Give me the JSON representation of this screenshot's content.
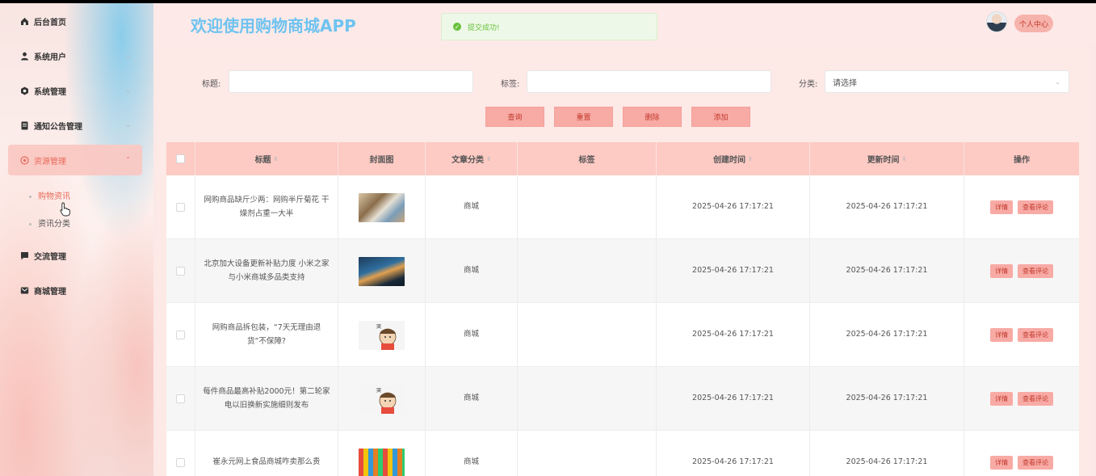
{
  "app": {
    "title": "欢迎使用购物商城APP"
  },
  "toast": {
    "message": "提交成功!"
  },
  "header": {
    "user_button": "个人中心"
  },
  "sidebar": {
    "items": [
      {
        "label": "后台首页",
        "icon": "home-icon",
        "expandable": false
      },
      {
        "label": "系统用户",
        "icon": "user-icon",
        "expandable": true
      },
      {
        "label": "系统管理",
        "icon": "gear-icon",
        "expandable": true
      },
      {
        "label": "通知公告管理",
        "icon": "document-icon",
        "expandable": true
      },
      {
        "label": "资源管理",
        "icon": "resource-icon",
        "expandable": true,
        "active": true
      },
      {
        "label": "交流管理",
        "icon": "chat-icon",
        "expandable": false
      },
      {
        "label": "商城管理",
        "icon": "mail-icon",
        "expandable": false
      }
    ],
    "sub_items": [
      {
        "label": "购物资讯",
        "active": true
      },
      {
        "label": "资讯分类",
        "active": false
      }
    ]
  },
  "search": {
    "title_label": "标题:",
    "tag_label": "标签:",
    "category_label": "分类:",
    "category_placeholder": "请选择",
    "buttons": {
      "query": "查询",
      "reset": "重置",
      "delete": "删除",
      "add": "添加"
    }
  },
  "table": {
    "headers": {
      "title": "标题",
      "cover": "封面图",
      "category": "文章分类",
      "tags": "标签",
      "created": "创建时间",
      "updated": "更新时间",
      "actions": "操作"
    },
    "action_labels": {
      "detail": "详情",
      "comments": "查看评论"
    },
    "rows": [
      {
        "title": "网购商品缺斤少两：网购半斤菊花 干燥剂占重一大半",
        "category": "商城",
        "tags": "",
        "created": "2025-04-26 17:17:21",
        "updated": "2025-04-26 17:17:21",
        "cover": "cover-photo-1"
      },
      {
        "title": "北京加大设备更新补贴力度 小米之家与小米商城多品类支持",
        "category": "商城",
        "tags": "",
        "created": "2025-04-26 17:17:21",
        "updated": "2025-04-26 17:17:21",
        "cover": "cover-photo-2"
      },
      {
        "title": "网购商品拆包装，“7天无理由退货”不保障?",
        "category": "商城",
        "tags": "",
        "created": "2025-04-26 17:17:21",
        "updated": "2025-04-26 17:17:21",
        "cover": "cover-cartoon-1"
      },
      {
        "title": "每件商品最高补贴2000元！第二轮家电以旧换新实施细则发布",
        "category": "商城",
        "tags": "",
        "created": "2025-04-26 17:17:21",
        "updated": "2025-04-26 17:17:21",
        "cover": "cover-cartoon-2"
      },
      {
        "title": "崔永元网上食品商城咋卖那么贵",
        "category": "商城",
        "tags": "",
        "created": "2025-04-26 17:17:21",
        "updated": "2025-04-26 17:17:21",
        "cover": "cover-photo-3"
      }
    ]
  },
  "colors": {
    "accent": "#f8aaa5",
    "title_blue": "#6fc3f0",
    "header_bg": "#fdcac4",
    "success": "#67c23a"
  }
}
